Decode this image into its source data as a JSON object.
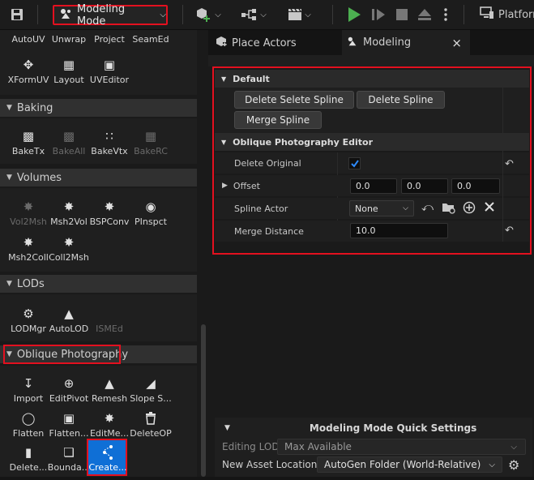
{
  "toolbar": {
    "save_icon": "save-icon",
    "mode_label": "Modeling Mode",
    "platforms_label": "Platform",
    "accent_red": "#e3101f",
    "play_color": "#4caf50"
  },
  "left_panel": {
    "top_tools": [
      {
        "label": "AutoUV"
      },
      {
        "label": "Unwrap"
      },
      {
        "label": "Project"
      },
      {
        "label": "SeamEd"
      },
      {
        "label": "XFormUV"
      },
      {
        "label": "Layout"
      },
      {
        "label": "UVEditor"
      }
    ],
    "sections": {
      "baking": {
        "title": "Baking",
        "tools": [
          {
            "label": "BakeTx",
            "enabled": true
          },
          {
            "label": "BakeAll",
            "enabled": false
          },
          {
            "label": "BakeVtx",
            "enabled": true
          },
          {
            "label": "BakeRC",
            "enabled": false
          }
        ]
      },
      "volumes": {
        "title": "Volumes",
        "tools": [
          {
            "label": "Vol2Msh",
            "enabled": false
          },
          {
            "label": "Msh2Vol",
            "enabled": true
          },
          {
            "label": "BSPConv",
            "enabled": true
          },
          {
            "label": "PInspct",
            "enabled": true
          },
          {
            "label": "Msh2Coll",
            "enabled": true
          },
          {
            "label": "Coll2Msh",
            "enabled": true
          }
        ]
      },
      "lods": {
        "title": "LODs",
        "tools": [
          {
            "label": "LODMgr",
            "enabled": true
          },
          {
            "label": "AutoLOD",
            "enabled": true
          },
          {
            "label": "ISMEd",
            "enabled": false
          }
        ]
      },
      "oblique": {
        "title": "Oblique Photography",
        "tools": [
          {
            "label": "Import"
          },
          {
            "label": "EditPivot"
          },
          {
            "label": "Remesh"
          },
          {
            "label": "Slope S..."
          },
          {
            "label": "Flatten"
          },
          {
            "label": "Flatten..."
          },
          {
            "label": "EditMe..."
          },
          {
            "label": "DeleteOP"
          },
          {
            "label": "Delete..."
          },
          {
            "label": "Bounda..."
          },
          {
            "label": "Create..."
          }
        ]
      }
    }
  },
  "tabs": [
    {
      "label": "Place Actors"
    },
    {
      "label": "Modeling",
      "close": "×"
    }
  ],
  "details": {
    "default_category": "Default",
    "buttons": {
      "delete_selete_spline": "Delete Selete Spline",
      "delete_spline": "Delete Spline",
      "merge_spline": "Merge Spline"
    },
    "editor_category": "Oblique Photography Editor",
    "delete_original": {
      "label": "Delete Original",
      "checked": true
    },
    "offset": {
      "label": "Offset",
      "x": "0.0",
      "y": "0.0",
      "z": "0.0"
    },
    "spline_actor": {
      "label": "Spline Actor",
      "value": "None"
    },
    "merge_distance": {
      "label": "Merge Distance",
      "value": "10.0"
    }
  },
  "quick_settings": {
    "title": "Modeling Mode Quick Settings",
    "editing_lod": {
      "label": "Editing LOD",
      "value": "Max Available"
    },
    "new_asset_location": {
      "label": "New Asset Location",
      "value": "AutoGen Folder (World-Relative)"
    }
  }
}
